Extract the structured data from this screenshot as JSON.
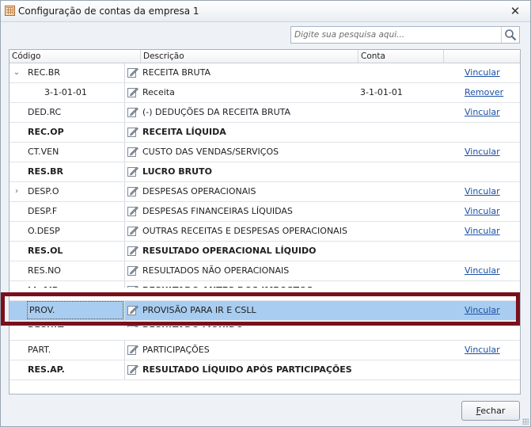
{
  "window": {
    "title": "Configuração de contas da empresa 1",
    "close_label": "✕"
  },
  "search": {
    "placeholder": "Digite sua pesquisa aqui...",
    "value": ""
  },
  "grid": {
    "columns": [
      "Código",
      "Descrição",
      "Conta"
    ],
    "rows": [
      {
        "expander": "⌄",
        "code": "REC.BR",
        "desc": "RECEITA BRUTA",
        "conta": "",
        "action": "Vincular",
        "bold": false,
        "child": false
      },
      {
        "expander": "",
        "code": "3-1-01-01",
        "desc": "Receita",
        "conta": "3-1-01-01",
        "action": "Remover",
        "bold": false,
        "child": true
      },
      {
        "expander": "",
        "code": "DED.RC",
        "desc": "(-) DEDUÇÕES DA RECEITA BRUTA",
        "conta": "",
        "action": "Vincular",
        "bold": false,
        "child": false
      },
      {
        "expander": "",
        "code": "REC.OP",
        "desc": "RECEITA LÍQUIDA",
        "conta": "",
        "action": "",
        "bold": true,
        "child": false
      },
      {
        "expander": "",
        "code": "CT.VEN",
        "desc": "CUSTO DAS VENDAS/SERVIÇOS",
        "conta": "",
        "action": "Vincular",
        "bold": false,
        "child": false
      },
      {
        "expander": "",
        "code": "RES.BR",
        "desc": "LUCRO BRUTO",
        "conta": "",
        "action": "",
        "bold": true,
        "child": false
      },
      {
        "expander": "›",
        "code": "DESP.O",
        "desc": "DESPESAS OPERACIONAIS",
        "conta": "",
        "action": "Vincular",
        "bold": false,
        "child": false
      },
      {
        "expander": "",
        "code": "DESP.F",
        "desc": "DESPESAS FINANCEIRAS LÍQUIDAS",
        "conta": "",
        "action": "Vincular",
        "bold": false,
        "child": false
      },
      {
        "expander": "",
        "code": "O.DESP",
        "desc": "OUTRAS RECEITAS E DESPESAS OPERACIONAIS",
        "conta": "",
        "action": "Vincular",
        "bold": false,
        "child": false
      },
      {
        "expander": "",
        "code": "RES.OL",
        "desc": "RESULTADO OPERACIONAL LÍQUIDO",
        "conta": "",
        "action": "",
        "bold": true,
        "child": false
      },
      {
        "expander": "",
        "code": "RES.NO",
        "desc": "RESULTADOS NÃO OPERACIONAIS",
        "conta": "",
        "action": "Vincular",
        "bold": false,
        "child": false
      },
      {
        "expander": "",
        "code": "LL.AIR",
        "desc": "RESULTADO ANTES DOS IMPOSTOS",
        "conta": "",
        "action": "",
        "bold": true,
        "child": false,
        "obscured": true
      },
      {
        "expander": "",
        "code": "PROV.",
        "desc": "PROVISÃO PARA IR E CSLL",
        "conta": "",
        "action": "Vincular",
        "bold": false,
        "child": false,
        "selected": true
      },
      {
        "expander": "",
        "code": "RESULT.",
        "desc": "RESULTADO LÍQUIDO",
        "conta": "",
        "action": "",
        "bold": true,
        "child": false,
        "obscured": true
      },
      {
        "expander": "",
        "code": "PART.",
        "desc": "PARTICIPAÇÕES",
        "conta": "",
        "action": "Vincular",
        "bold": false,
        "child": false
      },
      {
        "expander": "",
        "code": "RES.AP.",
        "desc": "RESULTADO LÍQUIDO APÓS PARTICIPAÇÕES",
        "conta": "",
        "action": "",
        "bold": true,
        "child": false
      }
    ]
  },
  "footer": {
    "close_button": "Fechar"
  },
  "colors": {
    "selection": "#a9cdf0",
    "highlight_border": "#7a0f1c",
    "link": "#1a4fa3"
  }
}
